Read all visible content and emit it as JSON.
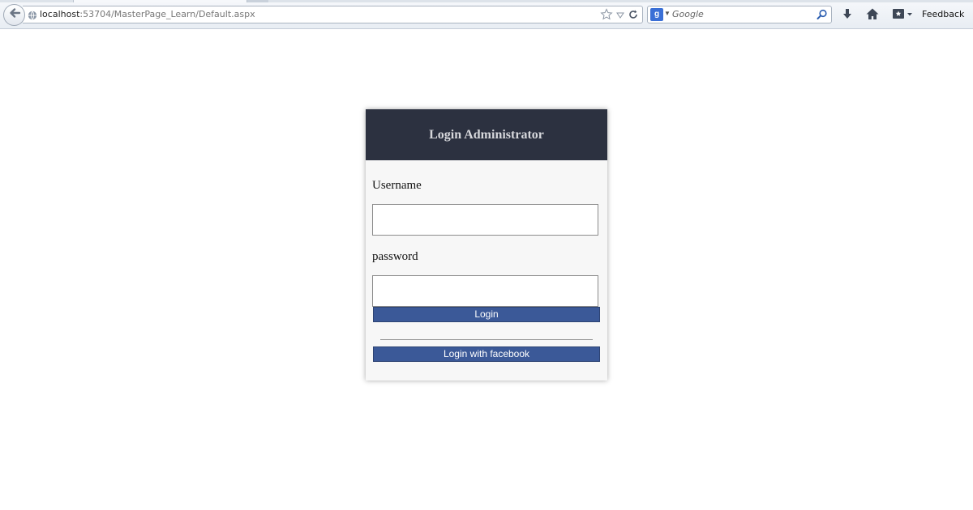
{
  "browser": {
    "url_host": "localhost",
    "url_rest": ":53704/MasterPage_Learn/Default.aspx",
    "search_engine_letter": "g",
    "search_placeholder": "Google",
    "feedback_label": "Feedback",
    "icons": {
      "back": "back-arrow-icon",
      "site": "globe-icon",
      "bookmark": "star-icon",
      "dropdown": "dropdown-arrow-icon",
      "reload": "reload-icon",
      "search": "magnifier-icon",
      "downloads": "download-arrow-icon",
      "home": "home-icon",
      "panel": "bookmarks-panel-icon"
    }
  },
  "login": {
    "title": "Login Administrator",
    "username_label": "Username",
    "username_value": "",
    "password_label": "password",
    "password_value": "",
    "login_button": "Login",
    "facebook_button": "Login with facebook",
    "colors": {
      "header_bg": "#2c3140",
      "button_bg": "#3b5998",
      "panel_bg": "#f7f7f7"
    }
  }
}
